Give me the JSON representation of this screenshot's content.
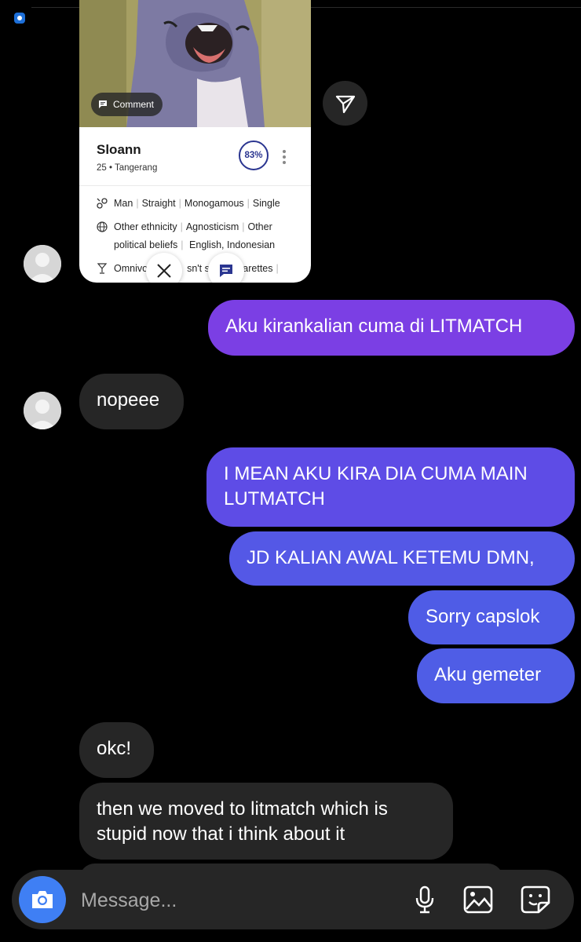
{
  "shared_card": {
    "comment_label": "Comment",
    "name": "Sloann",
    "subtitle": "25 • Tangerang",
    "match_percent": "83%",
    "tags_row1": [
      "Man",
      "Straight",
      "Monogamous",
      "Single"
    ],
    "tags_row2_a": [
      "Other ethnicity",
      "Agnosticism",
      "Other"
    ],
    "tags_row2_b": [
      "political beliefs",
      "English, Indonesian"
    ],
    "tags_row3_visible": [
      "Omnivo",
      "sn't sm",
      "arettes"
    ]
  },
  "messages": [
    {
      "side": "in",
      "text": "nopeee"
    },
    {
      "side": "out",
      "text": "Aku kirankalian cuma di LITMATCH"
    },
    {
      "side": "out",
      "text": "I MEAN AKU KIRA DIA CUMA MAIN LUTMATCH"
    },
    {
      "side": "out",
      "text": "JD KALIAN AWAL KETEMU DMN,"
    },
    {
      "side": "out",
      "text": "Sorry capslok"
    },
    {
      "side": "out",
      "text": "Aku gemeter"
    },
    {
      "side": "in",
      "text": "okc!"
    },
    {
      "side": "in",
      "text": "then we moved to litmatch which is stupid now that i think about it"
    }
  ],
  "composer": {
    "placeholder": "Message...",
    "icons": [
      "camera-icon",
      "microphone-icon",
      "gallery-icon",
      "sticker-icon"
    ]
  },
  "colors": {
    "background": "#000000",
    "incoming_bubble": "#262626",
    "outgoing_top": "#7b3fe4",
    "outgoing_bottom": "#4f5ce6",
    "camera_button": "#3f7ff4",
    "match_ring": "#2a3590"
  }
}
